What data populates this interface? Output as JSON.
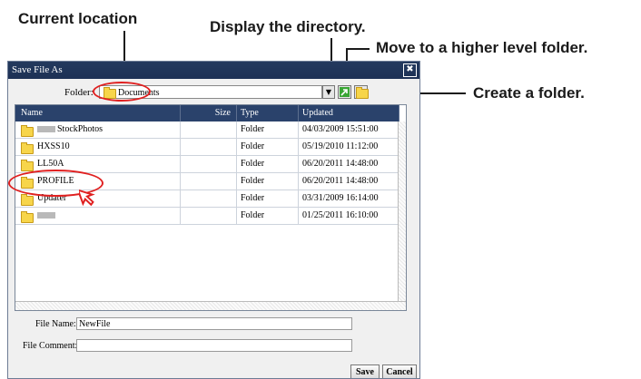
{
  "callouts": {
    "current_location": "Current location",
    "display_directory": "Display the directory.",
    "move_higher": "Move to a higher level folder.",
    "create_folder": "Create a folder."
  },
  "dialog": {
    "title": "Save File As",
    "close_glyph": "✖",
    "folder_label": "Folder:",
    "folder_value": "Documents",
    "columns": {
      "name": "Name",
      "size": "Size",
      "type": "Type",
      "updated": "Updated"
    },
    "rows": [
      {
        "name": "StockPhotos",
        "size": "",
        "type": "Folder",
        "updated": "04/03/2009 15:51:00"
      },
      {
        "name": "HXSS10",
        "size": "",
        "type": "Folder",
        "updated": "05/19/2010 11:12:00"
      },
      {
        "name": "LL50A",
        "size": "",
        "type": "Folder",
        "updated": "06/20/2011 14:48:00"
      },
      {
        "name": "PROFILE",
        "size": "",
        "type": "Folder",
        "updated": "06/20/2011 14:48:00"
      },
      {
        "name": "Updater",
        "size": "",
        "type": "Folder",
        "updated": "03/31/2009 16:14:00"
      },
      {
        "name": "",
        "size": "",
        "type": "Folder",
        "updated": "01/25/2011 16:10:00"
      }
    ],
    "file_name_label": "File Name:",
    "file_name_value": "NewFile",
    "file_comment_label": "File Comment:",
    "file_comment_value": "",
    "save_label": "Save",
    "cancel_label": "Cancel"
  },
  "colors": {
    "titlebar": "#1d3155",
    "highlight": "#e02020",
    "folder": "#f7d54a"
  },
  "icons": [
    "folder-icon",
    "up-folder-icon",
    "new-folder-icon",
    "close-icon",
    "cursor-arrow-icon"
  ]
}
